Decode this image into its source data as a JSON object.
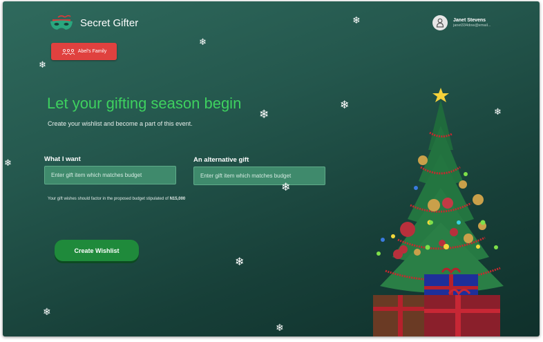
{
  "header": {
    "app_name": "Secret Gifter",
    "family_button_label": "Abel's Family",
    "user_name": "Janet Stevens",
    "user_email": "janet334dow@email..."
  },
  "hero": {
    "headline": "Let your gifting season begin",
    "subheadline": "Create your wishlist and become a part of this event."
  },
  "form": {
    "want_label": "What I want",
    "want_placeholder": "Enter gift item which matches budget",
    "alt_label": "An alternative gift",
    "alt_placeholder": "Enter gift item which matches budget",
    "budget_note": "Your gift wishes should factor in the proposed budget stipulated of ",
    "budget_amount": "N15,000",
    "submit_label": "Create Wishlist"
  },
  "icons": [
    "mask-icon",
    "family-icon",
    "user-icon",
    "snowflake-icon",
    "christmas-tree-icon"
  ],
  "colors": {
    "background": "#24574d",
    "accent_green": "#3ed15f",
    "button_red": "#e0413f",
    "button_green": "#1f8a3b"
  }
}
